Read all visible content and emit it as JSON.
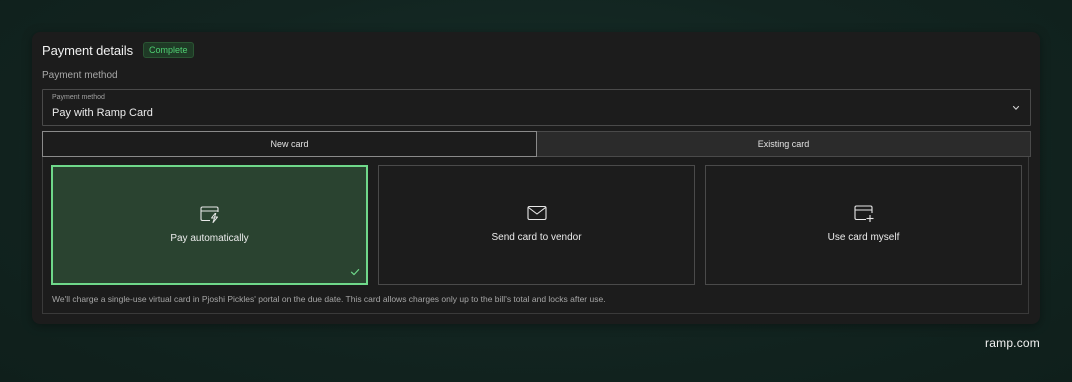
{
  "header": {
    "title": "Payment details",
    "status_badge": "Complete"
  },
  "payment_method": {
    "section_label": "Payment method",
    "field_caption": "Payment method",
    "selected_value": "Pay with Ramp Card"
  },
  "tabs": [
    {
      "label": "New card",
      "active": true
    },
    {
      "label": "Existing card",
      "active": false
    }
  ],
  "options": [
    {
      "label": "Pay automatically",
      "icon": "card-lightning-icon",
      "selected": true
    },
    {
      "label": "Send card to vendor",
      "icon": "envelope-icon",
      "selected": false
    },
    {
      "label": "Use card myself",
      "icon": "card-plus-icon",
      "selected": false
    }
  ],
  "note": "We'll charge a single-use virtual card in Pjoshi Pickles' portal on the due date. This card allows charges only up to the bill's total and locks after use.",
  "brand": "ramp.com",
  "colors": {
    "accent": "#6fd88a",
    "badge_text": "#4fcf72",
    "selected_bg": "#2a4330",
    "panel_bg": "#1c1c1c"
  }
}
